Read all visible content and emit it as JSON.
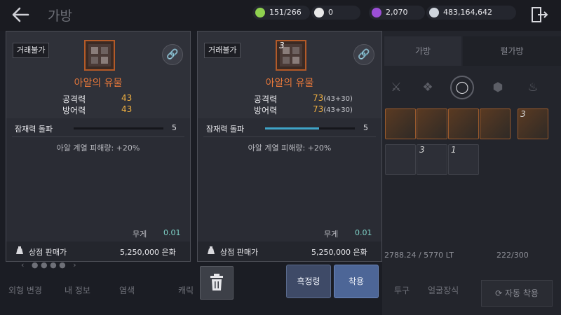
{
  "header": {
    "title": "가방",
    "resources": [
      {
        "icon": "energy-icon",
        "value": "151/266",
        "color": "#8fd14f"
      },
      {
        "icon": "pearl-icon",
        "value": "0",
        "color": "#e8e8e8"
      },
      {
        "icon": "crystal-icon",
        "value": "2,070",
        "color": "#9b4fd6"
      },
      {
        "icon": "silver-icon",
        "value": "483,164,642",
        "color": "#cfd5dd"
      }
    ]
  },
  "background": {
    "tabs": [
      "가방",
      "펄가방"
    ],
    "weight": "2788.24 / 5770 LT",
    "bag_count": "222/300",
    "auto_button": "자동 착용",
    "bottom_left": [
      "외형 변경",
      "내 정보",
      "염색"
    ],
    "bottom_mid": [
      "캐릭",
      "투구",
      "얼굴장식"
    ],
    "slot_counts": [
      "3",
      "3",
      "1"
    ]
  },
  "popups": [
    {
      "trade_badge": "거래불가",
      "item_count": "",
      "name": "아알의 유물",
      "stats": [
        {
          "label": "공격력",
          "value": "43",
          "bonus": ""
        },
        {
          "label": "방어력",
          "value": "43",
          "bonus": ""
        }
      ],
      "potential_label": "잠재력 돌파",
      "potential_value": "5",
      "potential_fill": 0,
      "effect": "아알 계열 피해량: +20%",
      "weight_label": "무게",
      "weight_value": "0.01",
      "sell_label": "상점 판매가",
      "sell_value": "5,250,000 은화"
    },
    {
      "trade_badge": "거래불가",
      "item_count": "3",
      "name": "아알의 유물",
      "stats": [
        {
          "label": "공격력",
          "value": "73",
          "bonus": "(43+30)"
        },
        {
          "label": "방어력",
          "value": "73",
          "bonus": "(43+30)"
        }
      ],
      "potential_label": "잠재력 돌파",
      "potential_value": "5",
      "potential_fill": 0.6,
      "effect": "아알 계열 피해량: +20%",
      "weight_label": "무게",
      "weight_value": "0.01",
      "sell_label": "상점 판매가",
      "sell_value": "5,250,000 은화"
    }
  ],
  "actions": {
    "black_stone_button": "흑정령",
    "equip_button": "착용"
  }
}
